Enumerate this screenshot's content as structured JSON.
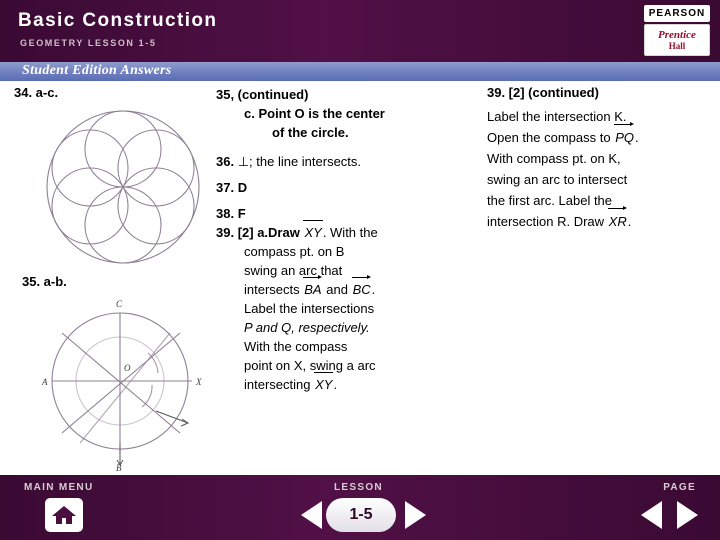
{
  "header": {
    "title": "Basic Construction",
    "subtitle": "GEOMETRY LESSON 1-5",
    "pearson": "PEARSON",
    "ph_line1": "Prentice",
    "ph_line2": "Hall"
  },
  "band": {
    "label": "Student Edition Answers"
  },
  "left": {
    "q34_label": "34.  a-c.",
    "q35_label": "35.  a-b.",
    "figure_flower_name": "flower-of-life-construction",
    "figure_circle_name": "circle-angle-bisector-construction",
    "figure_circle_labels": [
      "C",
      "O",
      "A",
      "X",
      "B"
    ]
  },
  "middle": {
    "l1": "35, (continued)",
    "l2": "c. Point O is the center",
    "l3": "of the circle.",
    "l4_num": "36.",
    "l4_text": "; the line intersects.",
    "l4_symbol": "⊥",
    "l5_num": "37.",
    "l5_text": "D",
    "l6_num": "38.",
    "l6_text": "F",
    "l7_num": "39.",
    "l7_a": "[2] a.Draw",
    "l7_seg": "XY",
    "l7_b": ". With the",
    "l8": "compass pt. on B",
    "l9": "swing an arc that",
    "l10_a": "intersects",
    "l10_ray1": "BA",
    "l10_b": "and",
    "l10_ray2": "BC",
    "l10_c": ".",
    "l11": "Label the intersections",
    "l12": "P and Q, respectively.",
    "l13": " With the compass",
    "l14": "point on X, swing a arc",
    "l15_a": "intersecting",
    "l15_seg": "XY",
    "l15_b": "."
  },
  "right": {
    "head": "39. [2] (continued)",
    "l1": "Label the intersection K.",
    "l2_a": "Open the compass to",
    "l2_ray": "PQ",
    "l2_b": ".",
    "l3": "With compass pt. on K,",
    "l4": "swing an arc to intersect",
    "l5": "the first arc. Label the",
    "l6_a": "intersection R. Draw",
    "l6_ray": "XR",
    "l6_b": "."
  },
  "footer": {
    "main_menu": "MAIN MENU",
    "lesson": "LESSON",
    "page": "PAGE",
    "lesson_number": "1-5",
    "home_icon": "home-icon",
    "prev_icon": "triangle-left-icon",
    "next_icon": "triangle-right-icon"
  }
}
